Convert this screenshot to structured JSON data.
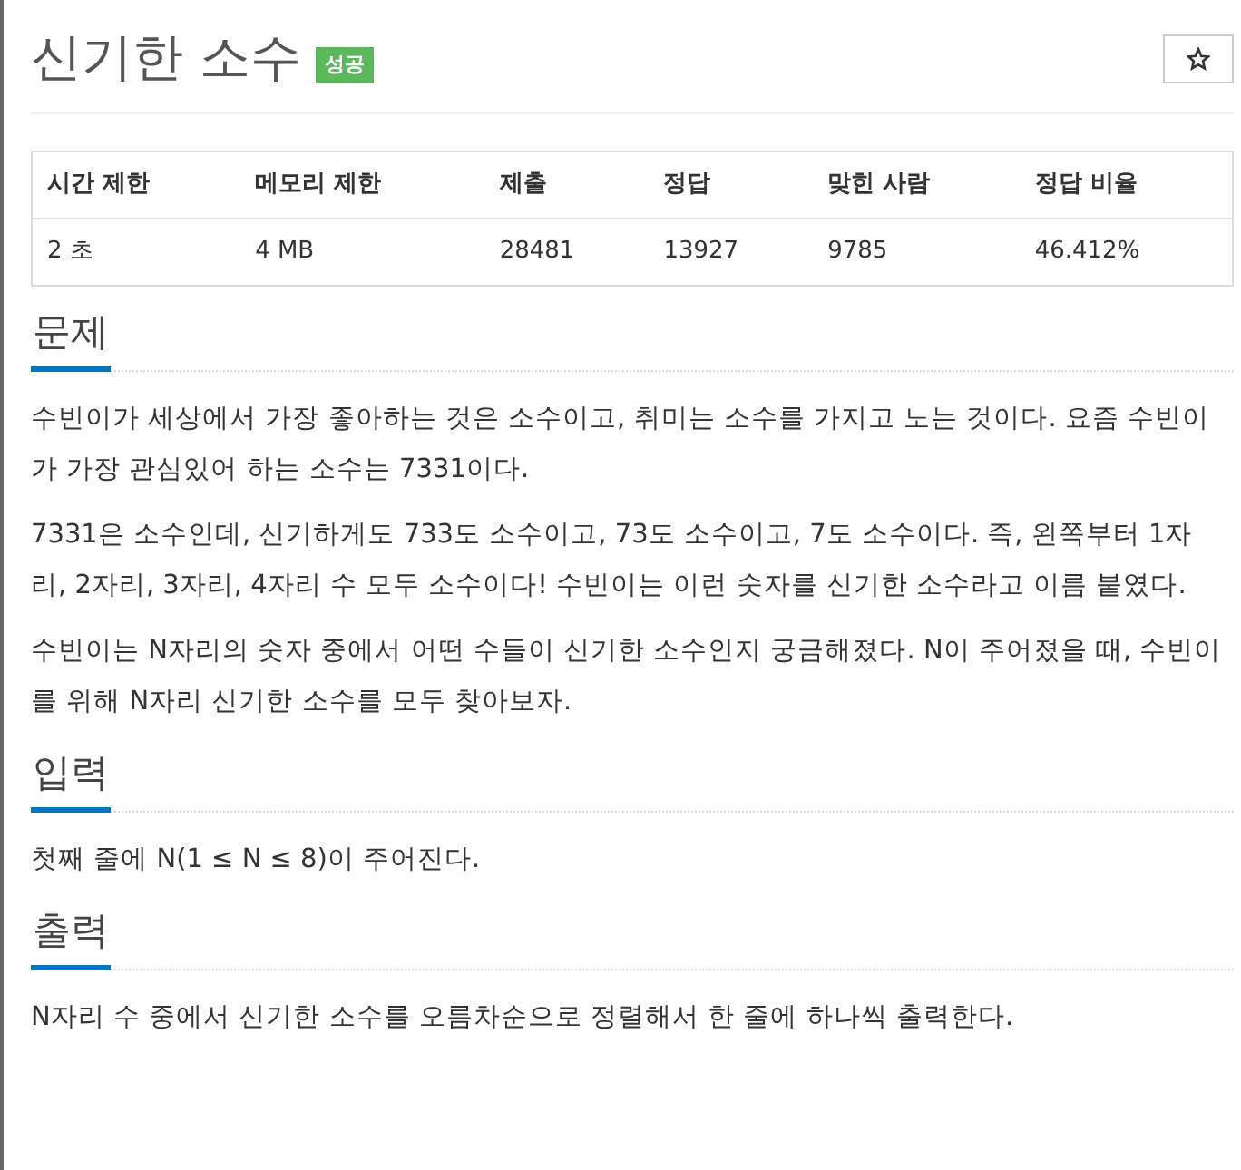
{
  "title": "신기한 소수",
  "badge": "성공",
  "stats_table": {
    "columns": [
      "시간 제한",
      "메모리 제한",
      "제출",
      "정답",
      "맞힌 사람",
      "정답 비율"
    ],
    "rows": [
      [
        "2 초",
        "4 MB",
        "28481",
        "13927",
        "9785",
        "46.412%"
      ]
    ]
  },
  "sections": [
    {
      "heading": "문제",
      "paragraphs": [
        "수빈이가 세상에서 가장 좋아하는 것은 소수이고, 취미는 소수를 가지고 노는 것이다. 요즘 수빈이가 가장 관심있어 하는 소수는 7331이다.",
        "7331은 소수인데, 신기하게도 733도 소수이고, 73도 소수이고, 7도 소수이다. 즉, 왼쪽부터 1자리, 2자리, 3자리, 4자리 수 모두 소수이다! 수빈이는 이런 숫자를 신기한 소수라고 이름 붙였다.",
        "수빈이는 N자리의 숫자 중에서 어떤 수들이 신기한 소수인지 궁금해졌다. N이 주어졌을 때, 수빈이를 위해 N자리 신기한 소수를 모두 찾아보자."
      ]
    },
    {
      "heading": "입력",
      "paragraphs": [
        "첫째 줄에 N(1 ≤ N ≤ 8)이 주어진다."
      ]
    },
    {
      "heading": "출력",
      "paragraphs": [
        "N자리 수 중에서 신기한 소수를 오름차순으로 정렬해서 한 줄에 하나씩 출력한다."
      ]
    }
  ]
}
